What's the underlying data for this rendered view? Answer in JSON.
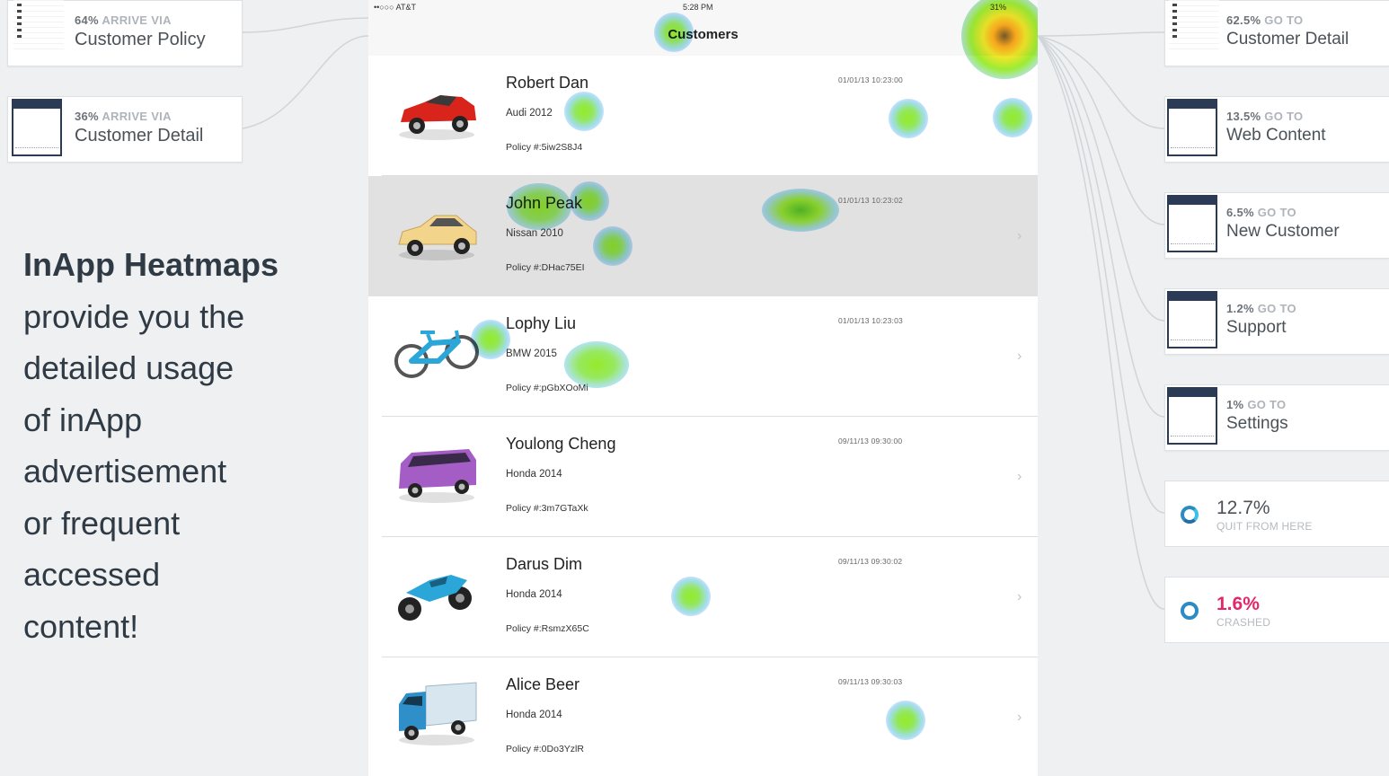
{
  "arrivals": [
    {
      "pct": "64%",
      "via": "ARRIVE VIA",
      "title": "Customer Policy"
    },
    {
      "pct": "36%",
      "via": "ARRIVE VIA",
      "title": "Customer Detail"
    }
  ],
  "promo": {
    "heading": "InApp Heatmaps",
    "lines": [
      "provide you the",
      "detailed usage",
      "of inApp",
      "advertisement",
      "or frequent",
      "accessed",
      "content!"
    ]
  },
  "phone": {
    "carrier": "••○○○ AT&T",
    "time": "5:28 PM",
    "battery": "31%",
    "nav_title": "Customers",
    "chevron": "›",
    "customers": [
      {
        "name": "Robert Dan",
        "car": "Audi 2012",
        "policy": "Policy #:5iw2S8J4",
        "date": "01/01/13 10:23:00",
        "icon": "red-sports-car-icon",
        "color": "#d8241b"
      },
      {
        "name": "John Peak",
        "car": "Nissan 2010",
        "policy": "Policy #:DHac75EI",
        "date": "01/01/13 10:23:02",
        "icon": "yellow-coupe-icon",
        "color": "#f2d48b"
      },
      {
        "name": "Lophy Liu",
        "car": "BMW 2015",
        "policy": "Policy #:pGbXOoMi",
        "date": "01/01/13 10:23:03",
        "icon": "bicycle-icon",
        "color": "#2aa6d8"
      },
      {
        "name": "Youlong Cheng",
        "car": "Honda 2014",
        "policy": "Policy #:3m7GTaXk",
        "date": "09/11/13 09:30:00",
        "icon": "purple-van-icon",
        "color": "#a35dc5"
      },
      {
        "name": "Darus Dim",
        "car": "Honda 2014",
        "policy": "Policy #:RsmzX65C",
        "date": "09/11/13 09:30:02",
        "icon": "motorcycle-icon",
        "color": "#2ba6d8"
      },
      {
        "name": "Alice Beer",
        "car": "Honda 2014",
        "policy": "Policy #:0Do3YzlR",
        "date": "09/11/13 09:30:03",
        "icon": "truck-icon",
        "color": "#2f8fc9"
      }
    ]
  },
  "destinations": [
    {
      "pct": "62.5%",
      "via": "GO TO",
      "title": "Customer Detail"
    },
    {
      "pct": "13.5%",
      "via": "GO TO",
      "title": "Web Content"
    },
    {
      "pct": "6.5%",
      "via": "GO TO",
      "title": "New Customer"
    },
    {
      "pct": "1.2%",
      "via": "GO TO",
      "title": "Support"
    },
    {
      "pct": "1%",
      "via": "GO TO",
      "title": "Settings"
    }
  ],
  "stats": {
    "quit": {
      "value": "12.7%",
      "label": "QUIT FROM HERE"
    },
    "crash": {
      "value": "1.6%",
      "label": "CRASHED",
      "color": "#e4266b"
    }
  },
  "colors": {
    "accent": "#2d8bc4",
    "thumb_navy": "#2b3a55",
    "crash": "#e4266b"
  }
}
